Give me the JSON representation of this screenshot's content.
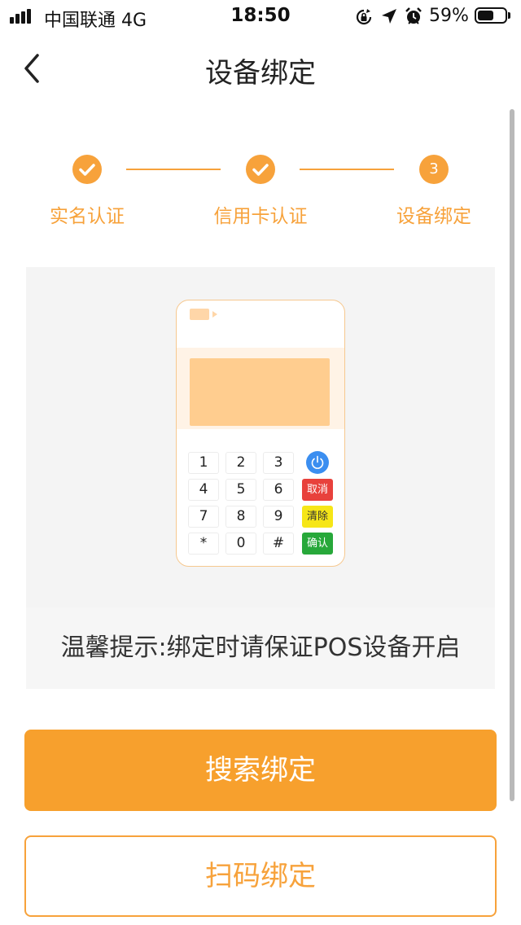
{
  "status_bar": {
    "carrier": "中国联通  4G",
    "time": "18:50",
    "battery": "59%",
    "battery_level": 0.59,
    "icons": [
      "rotation-lock-icon",
      "location-arrow-icon",
      "alarm-icon"
    ]
  },
  "nav": {
    "title": "设备绑定",
    "back_icon": "chevron-left-icon"
  },
  "steps": [
    {
      "label": "实名认证",
      "state": "done"
    },
    {
      "label": "信用卡认证",
      "state": "done"
    },
    {
      "label": "设备绑定",
      "state": "current",
      "number": "3"
    }
  ],
  "pos_illustration": {
    "keys": [
      "1",
      "2",
      "3",
      "4",
      "5",
      "6",
      "7",
      "8",
      "9",
      "*",
      "0",
      "#"
    ],
    "function_keys": [
      {
        "label": "取消",
        "color": "#e8413c",
        "text_color": "#ffffff"
      },
      {
        "label": "清除",
        "color": "#f6e617",
        "text_color": "#333333"
      },
      {
        "label": "确认",
        "color": "#27a83a",
        "text_color": "#ffffff"
      }
    ],
    "power_color": "#3b8ef0"
  },
  "tip": {
    "text": "温馨提示:绑定时请保证POS设备开启"
  },
  "buttons": {
    "search_bind": "搜索绑定",
    "scan_bind": "扫码绑定"
  },
  "colors": {
    "accent": "#f7a23b",
    "primary_button": "#f7a02d"
  }
}
